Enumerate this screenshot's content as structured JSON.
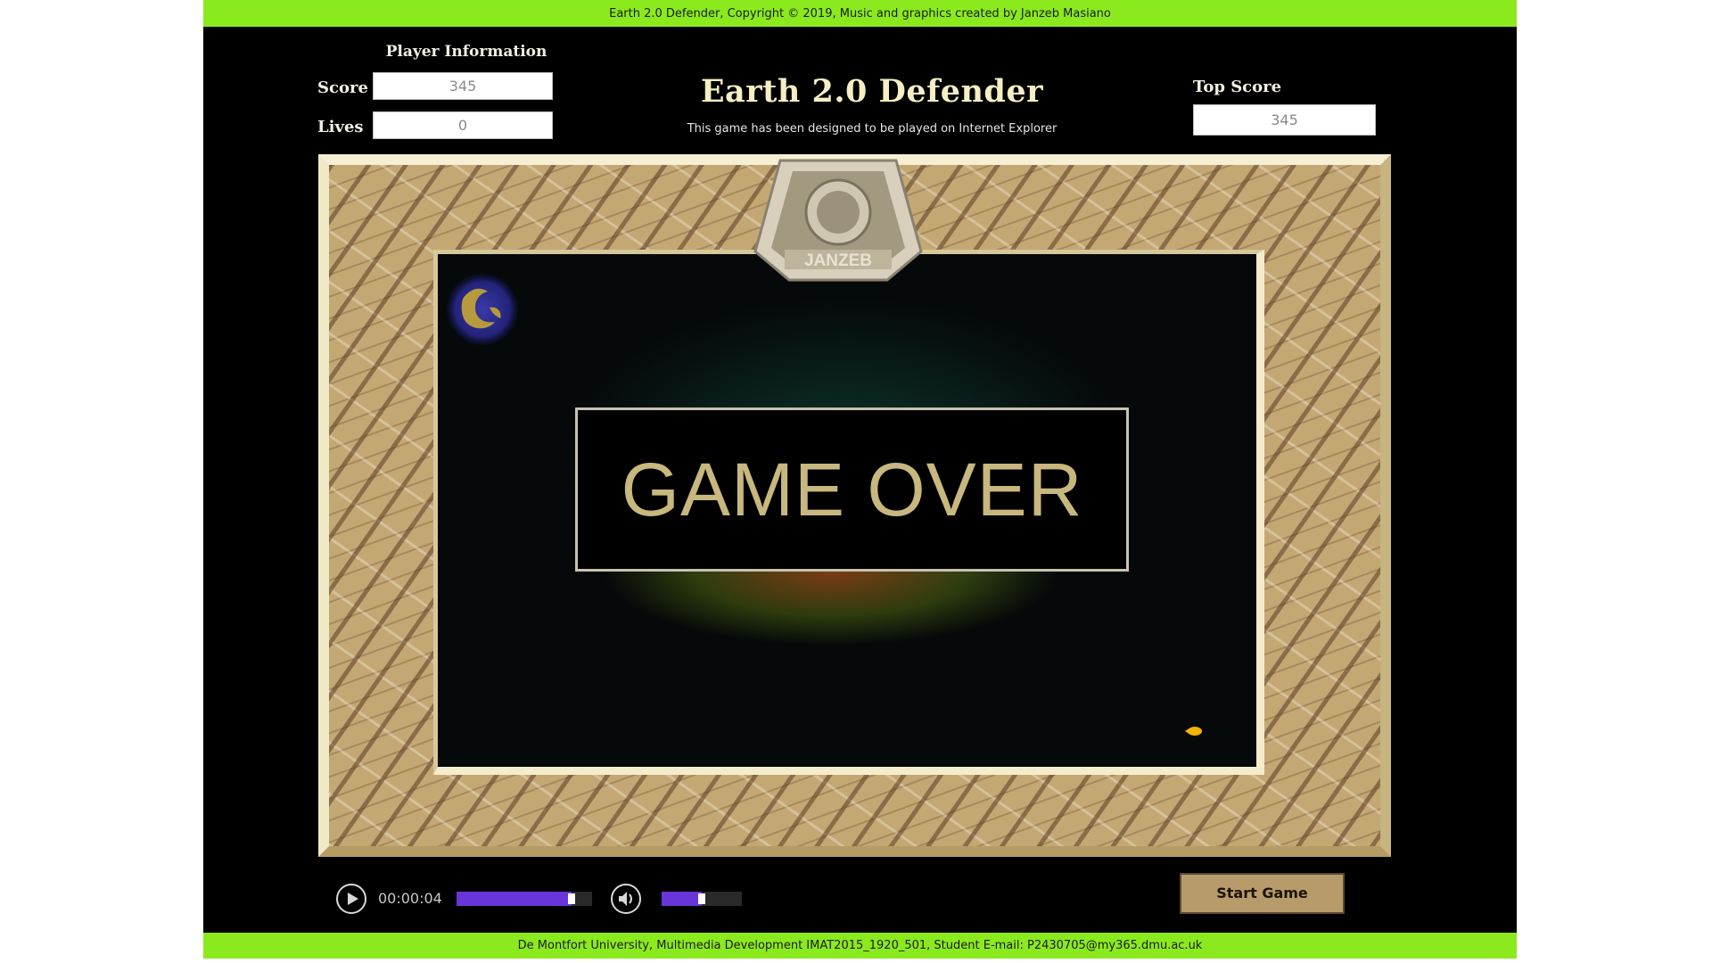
{
  "header_bar": "Earth 2.0 Defender, Copyright © 2019, Music and graphics created by Janzeb Masiano",
  "footer_bar": "De Montfort University, Multimedia Development IMAT2015_1920_501, Student E-mail: P2430705@my365.dmu.ac.uk",
  "player_info": {
    "heading": "Player Information",
    "score_label": "Score",
    "score_value": "345",
    "lives_label": "Lives",
    "lives_value": "0"
  },
  "title": "Earth 2.0 Defender",
  "subtitle": "This game has been designed to be played on Internet Explorer",
  "top_score": {
    "label": "Top Score",
    "value": "345"
  },
  "game": {
    "overlay_text": "GAME OVER",
    "emblem_text": "JANZEB"
  },
  "media_player": {
    "time": "00:00:04",
    "progress_fraction": 0.85,
    "volume_fraction": 0.5
  },
  "start_button": "Start Game",
  "colors": {
    "accent_bar": "#8bea1e",
    "slider": "#6a35d8",
    "board_sand": "#c4a874",
    "overlay_text": "#c8b77e"
  },
  "icons": [
    "play-icon",
    "volume-icon",
    "planet-icon",
    "emblem-icon",
    "ship-icon"
  ]
}
